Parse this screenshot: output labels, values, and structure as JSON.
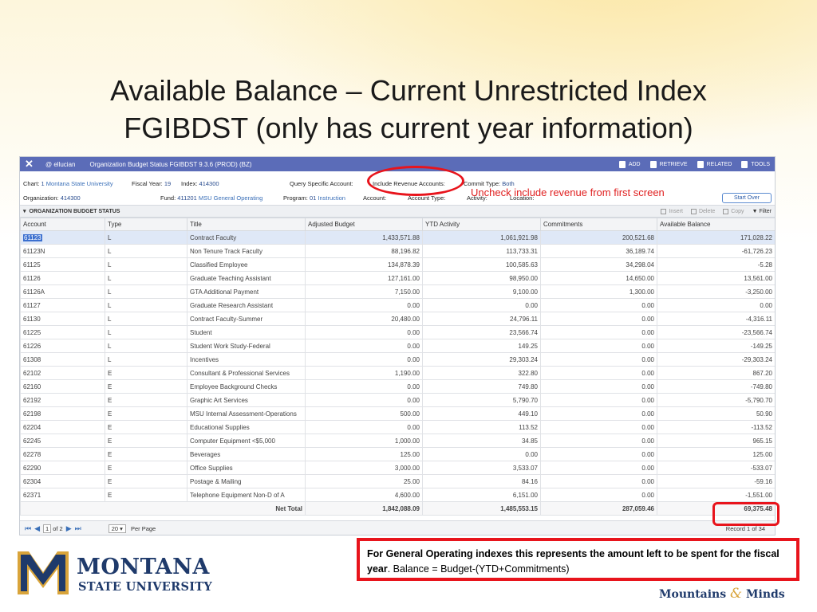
{
  "slide": {
    "title_line1": "Available Balance – Current Unrestricted Index",
    "title_line2": "FGIBDST (only has current year information)"
  },
  "app": {
    "close_glyph": "✕",
    "brand": "@ ellucian",
    "window_title": "Organization Budget Status FGIBDST 9.3.6 (PROD) (BZ)",
    "toolbar": {
      "add": "ADD",
      "retrieve": "RETRIEVE",
      "related": "RELATED",
      "tools": "TOOLS"
    },
    "key": {
      "chart_label": "Chart:",
      "chart_value": "1",
      "chart_desc": "Montana State University",
      "fiscal_year_label": "Fiscal Year:",
      "fiscal_year_value": "19",
      "index_label": "Index:",
      "index_value": "414300",
      "query_label": "Query Specific Account:",
      "include_rev_label": "Include Revenue Accounts:",
      "commit_type_label": "Commit Type:",
      "commit_type_value": "Both",
      "org_label": "Organization:",
      "org_value": "414300",
      "fund_label": "Fund:",
      "fund_value": "411201",
      "fund_desc": "MSU General Operating",
      "program_label": "Program:",
      "program_value": "01",
      "program_desc": "Instruction",
      "account_label": "Account:",
      "account_type_label": "Account Type:",
      "activity_label": "Activity:",
      "location_label": "Location:",
      "start_over": "Start Over"
    },
    "section": {
      "title": "ORGANIZATION BUDGET STATUS",
      "insert": "Insert",
      "delete": "Delete",
      "copy": "Copy",
      "filter": "Filter"
    },
    "columns": [
      "Account",
      "Type",
      "Title",
      "Adjusted Budget",
      "YTD Activity",
      "Commitments",
      "Available Balance"
    ],
    "rows": [
      [
        "61123",
        "L",
        "Contract Faculty",
        "1,433,571.88",
        "1,061,921.98",
        "200,521.68",
        "171,028.22"
      ],
      [
        "61123N",
        "L",
        "Non Tenure Track Faculty",
        "88,196.82",
        "113,733.31",
        "36,189.74",
        "-61,726.23"
      ],
      [
        "61125",
        "L",
        "Classified Employee",
        "134,878.39",
        "100,585.63",
        "34,298.04",
        "-5.28"
      ],
      [
        "61126",
        "L",
        "Graduate Teaching Assistant",
        "127,161.00",
        "98,950.00",
        "14,650.00",
        "13,561.00"
      ],
      [
        "61126A",
        "L",
        "GTA Additional Payment",
        "7,150.00",
        "9,100.00",
        "1,300.00",
        "-3,250.00"
      ],
      [
        "61127",
        "L",
        "Graduate Research Assistant",
        "0.00",
        "0.00",
        "0.00",
        "0.00"
      ],
      [
        "61130",
        "L",
        "Contract Faculty-Summer",
        "20,480.00",
        "24,796.11",
        "0.00",
        "-4,316.11"
      ],
      [
        "61225",
        "L",
        "Student",
        "0.00",
        "23,566.74",
        "0.00",
        "-23,566.74"
      ],
      [
        "61226",
        "L",
        "Student Work Study-Federal",
        "0.00",
        "149.25",
        "0.00",
        "-149.25"
      ],
      [
        "61308",
        "L",
        "Incentives",
        "0.00",
        "29,303.24",
        "0.00",
        "-29,303.24"
      ],
      [
        "62102",
        "E",
        "Consultant & Professional Services",
        "1,190.00",
        "322.80",
        "0.00",
        "867.20"
      ],
      [
        "62160",
        "E",
        "Employee Background Checks",
        "0.00",
        "749.80",
        "0.00",
        "-749.80"
      ],
      [
        "62192",
        "E",
        "Graphic Art Services",
        "0.00",
        "5,790.70",
        "0.00",
        "-5,790.70"
      ],
      [
        "62198",
        "E",
        "MSU Internal Assessment-Operations",
        "500.00",
        "449.10",
        "0.00",
        "50.90"
      ],
      [
        "62204",
        "E",
        "Educational Supplies",
        "0.00",
        "113.52",
        "0.00",
        "-113.52"
      ],
      [
        "62245",
        "E",
        "Computer Equipment <$5,000",
        "1,000.00",
        "34.85",
        "0.00",
        "965.15"
      ],
      [
        "62278",
        "E",
        "Beverages",
        "125.00",
        "0.00",
        "0.00",
        "125.00"
      ],
      [
        "62290",
        "E",
        "Office Supplies",
        "3,000.00",
        "3,533.07",
        "0.00",
        "-533.07"
      ],
      [
        "62304",
        "E",
        "Postage & Mailing",
        "25.00",
        "84.16",
        "0.00",
        "-59.16"
      ],
      [
        "62371",
        "E",
        "Telephone Equipment Non-D of A",
        "4,600.00",
        "6,151.00",
        "0.00",
        "-1,551.00"
      ]
    ],
    "total": {
      "label": "Net Total",
      "adjusted_budget": "1,842,088.09",
      "ytd_activity": "1,485,553.15",
      "commitments": "287,059.46",
      "available_balance": "69,375.48"
    },
    "pager": {
      "first": "⏮",
      "prev": "◀",
      "page": "1",
      "of": "of 2",
      "next": "▶",
      "last": "⏭",
      "per_page_value": "20 ▾",
      "per_page_label": "Per Page",
      "record": "Record 1 of 34"
    }
  },
  "annotation": "Uncheck include revenue from first screen",
  "note": {
    "bold": "For General Operating indexes this represents the amount left to be spent for the fiscal year",
    "rest": ".   Balance = Budget-(YTD+Commitments)"
  },
  "logo": {
    "line1": "MONTANA",
    "line2": "STATE UNIVERSITY"
  },
  "tagline": {
    "part1": "Mountains ",
    "amp": "&",
    "part2": " Minds"
  },
  "colors": {
    "accent_red": "#e8141c",
    "msu_blue": "#1f3a6b",
    "msu_gold": "#d9a43a",
    "topbar": "#5b6cb8"
  }
}
